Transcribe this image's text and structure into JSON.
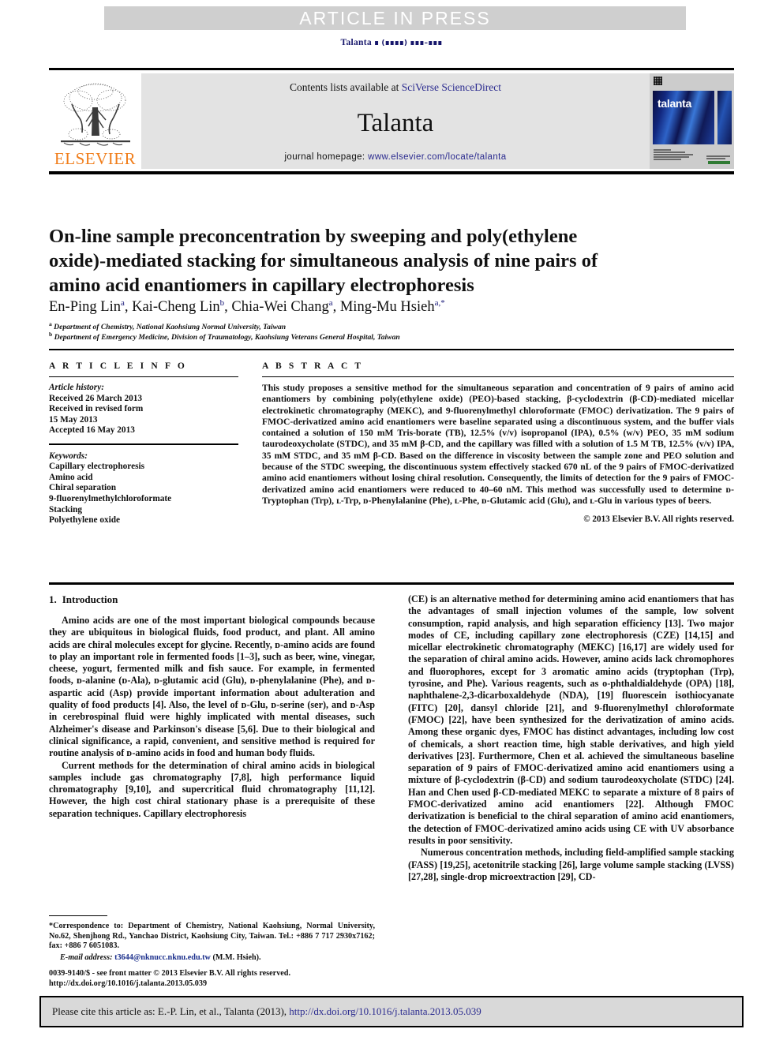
{
  "banner": {
    "text": "ARTICLE IN PRESS"
  },
  "running_head": {
    "journal": "Talanta",
    "volume_mark": "∎",
    "year_mark": "(∎∎∎∎)",
    "pages_mark": "∎∎∎–∎∎∎"
  },
  "masthead": {
    "publisher": "ELSEVIER",
    "contents_prefix": "Contents lists available at ",
    "contents_link": "SciVerse ScienceDirect",
    "journal_name": "Talanta",
    "homepage_prefix": "journal homepage: ",
    "homepage_link": "www.elsevier.com/locate/talanta",
    "cover_title": "talanta"
  },
  "article": {
    "title": "On-line sample preconcentration by sweeping and poly(ethylene oxide)-mediated stacking for simultaneous analysis of nine pairs of amino acid enantiomers in capillary electrophoresis",
    "authors": [
      {
        "name": "En-Ping Lin",
        "marks": "a"
      },
      {
        "name": "Kai-Cheng Lin",
        "marks": "b"
      },
      {
        "name": "Chia-Wei Chang",
        "marks": "a"
      },
      {
        "name": "Ming-Mu Hsieh",
        "marks": "a,*"
      }
    ],
    "affiliations": [
      {
        "mark": "a",
        "text": "Department of Chemistry, National Kaohsiung Normal University, Taiwan"
      },
      {
        "mark": "b",
        "text": "Department of Emergency Medicine, Division of Traumatology, Kaohsiung Veterans General Hospital, Taiwan"
      }
    ]
  },
  "info": {
    "heading": "A R T I C L E   I N F O",
    "history_label": "Article history:",
    "history": [
      "Received 26 March 2013",
      "Received in revised form",
      "15 May 2013",
      "Accepted 16 May 2013"
    ],
    "keywords_label": "Keywords:",
    "keywords": [
      "Capillary electrophoresis",
      "Amino acid",
      "Chiral separation",
      "9-fluorenylmethylchloroformate",
      "Stacking",
      "Polyethylene oxide"
    ]
  },
  "abstract": {
    "heading": "A B S T R A C T",
    "text": "This study proposes a sensitive method for the simultaneous separation and concentration of 9 pairs of amino acid enantiomers by combining poly(ethylene oxide) (PEO)-based stacking, β-cyclodextrin (β-CD)-mediated micellar electrokinetic chromatography (MEKC), and 9-fluorenylmethyl chloroformate (FMOC) derivatization. The 9 pairs of FMOC-derivatized amino acid enantiomers were baseline separated using a discontinuous system, and the buffer vials contained a solution of 150 mM Tris-borate (TB), 12.5% (v/v) isopropanol (IPA), 0.5% (w/v) PEO, 35 mM sodium taurodeoxycholate (STDC), and 35 mM β-CD, and the capillary was filled with a solution of 1.5 M TB, 12.5% (v/v) IPA, 35 mM STDC, and 35 mM β-CD. Based on the difference in viscosity between the sample zone and PEO solution and because of the STDC sweeping, the discontinuous system effectively stacked 670 nL of the 9 pairs of FMOC-derivatized amino acid enantiomers without losing chiral resolution. Consequently, the limits of detection for the 9 pairs of FMOC-derivatized amino acid enantiomers were reduced to 40–60 nM. This method was successfully used to determine ᴅ-Tryptophan (Trp), ʟ-Trp, ᴅ-Phenylalanine (Phe), ʟ-Phe, ᴅ-Glutamic acid (Glu), and ʟ-Glu in various types of beers.",
    "copyright": "© 2013 Elsevier B.V. All rights reserved."
  },
  "sections": {
    "intro_number": "1.",
    "intro_title": "Introduction"
  },
  "body": {
    "left_paragraphs": [
      "Amino acids are one of the most important biological compounds because they are ubiquitous in biological fluids, food product, and plant. All amino acids are chiral molecules except for glycine. Recently, ᴅ-amino acids are found to play an important role in fermented foods [1–3], such as beer, wine, vinegar, cheese, yogurt, fermented milk and fish sauce. For example, in fermented foods, ᴅ-alanine (ᴅ-Ala), ᴅ-glutamic acid (Glu), ᴅ-phenylalanine (Phe), and ᴅ-aspartic acid (Asp) provide important information about adulteration and quality of food products [4]. Also, the level of ᴅ-Glu, ᴅ-serine (ser), and ᴅ-Asp in cerebrospinal fluid were highly implicated with mental diseases, such Alzheimer's disease and Parkinson's disease [5,6]. Due to their biological and clinical significance, a rapid, convenient, and sensitive method is required for routine analysis of ᴅ-amino acids in food and human body fluids.",
      "Current methods for the determination of chiral amino acids in biological samples include gas chromatography [7,8], high performance liquid chromatography [9,10], and supercritical fluid chromatography [11,12]. However, the high cost chiral stationary phase is a prerequisite of these separation techniques. Capillary electrophoresis"
    ],
    "right_paragraphs": [
      "(CE) is an alternative method for determining amino acid enantiomers that has the advantages of small injection volumes of the sample, low solvent consumption, rapid analysis, and high separation efficiency [13]. Two major modes of CE, including capillary zone electrophoresis (CZE) [14,15] and micellar electrokinetic chromatography (MEKC) [16,17] are widely used for the separation of chiral amino acids. However, amino acids lack chromophores and fluorophores, except for 3 aromatic amino acids (tryptophan (Trp), tyrosine, and Phe). Various reagents, such as o-phthaldialdehyde (OPA) [18], naphthalene-2,3-dicarboxaldehyde (NDA), [19] fluorescein isothiocyanate (FITC) [20], dansyl chloride [21], and 9-fluorenylmethyl chloroformate (FMOC) [22], have been synthesized for the derivatization of amino acids. Among these organic dyes, FMOC has distinct advantages, including low cost of chemicals, a short reaction time, high stable derivatives, and high yield derivatives [23]. Furthermore, Chen et al. achieved the simultaneous baseline separation of 9 pairs of FMOC-derivatized amino acid enantiomers using a mixture of β-cyclodextrin (β-CD) and sodium taurodeoxycholate (STDC) [24]. Han and Chen used β-CD-mediated MEKC to separate a mixture of 8 pairs of FMOC-derivatized amino acid enantiomers [22]. Although FMOC derivatization is beneficial to the chiral separation of amino acid enantiomers, the detection of FMOC-derivatized amino acids using CE with UV absorbance results in poor sensitivity.",
      "Numerous concentration methods, including field-amplified sample stacking (FASS) [19,25], acetonitrile stacking [26], large volume sample stacking (LVSS) [27,28], single-drop microextraction [29], CD-"
    ]
  },
  "footnote": {
    "correspondence": "*Correspondence to: Department of Chemistry, National Kaohsiung, Normal University, No.62, Shenjhong Rd., Yanchao District, Kaohsiung City, Taiwan. Tel.: +886 7 717 2930x7162; fax: +886 7 6051083.",
    "email_label": "E-mail address:",
    "email": "t3644@nknucc.nknu.edu.tw",
    "email_owner": "(M.M. Hsieh)."
  },
  "imprint": {
    "line1": "0039-9140/$ - see front matter © 2013 Elsevier B.V. All rights reserved.",
    "line2": "http://dx.doi.org/10.1016/j.talanta.2013.05.039"
  },
  "cite": {
    "prefix": "Please cite this article as: E.-P. Lin, et al., Talanta (2013), ",
    "doi": "http://dx.doi.org/10.1016/j.talanta.2013.05.039"
  },
  "colors": {
    "link": "#2b2b8f",
    "reference": "#1b2f8c",
    "elsevier_orange": "#f07d1a",
    "banner_bg": "#cfcfcf",
    "masthead_bg": "#e3e3e3",
    "cite_bg": "#d9d9d9"
  }
}
